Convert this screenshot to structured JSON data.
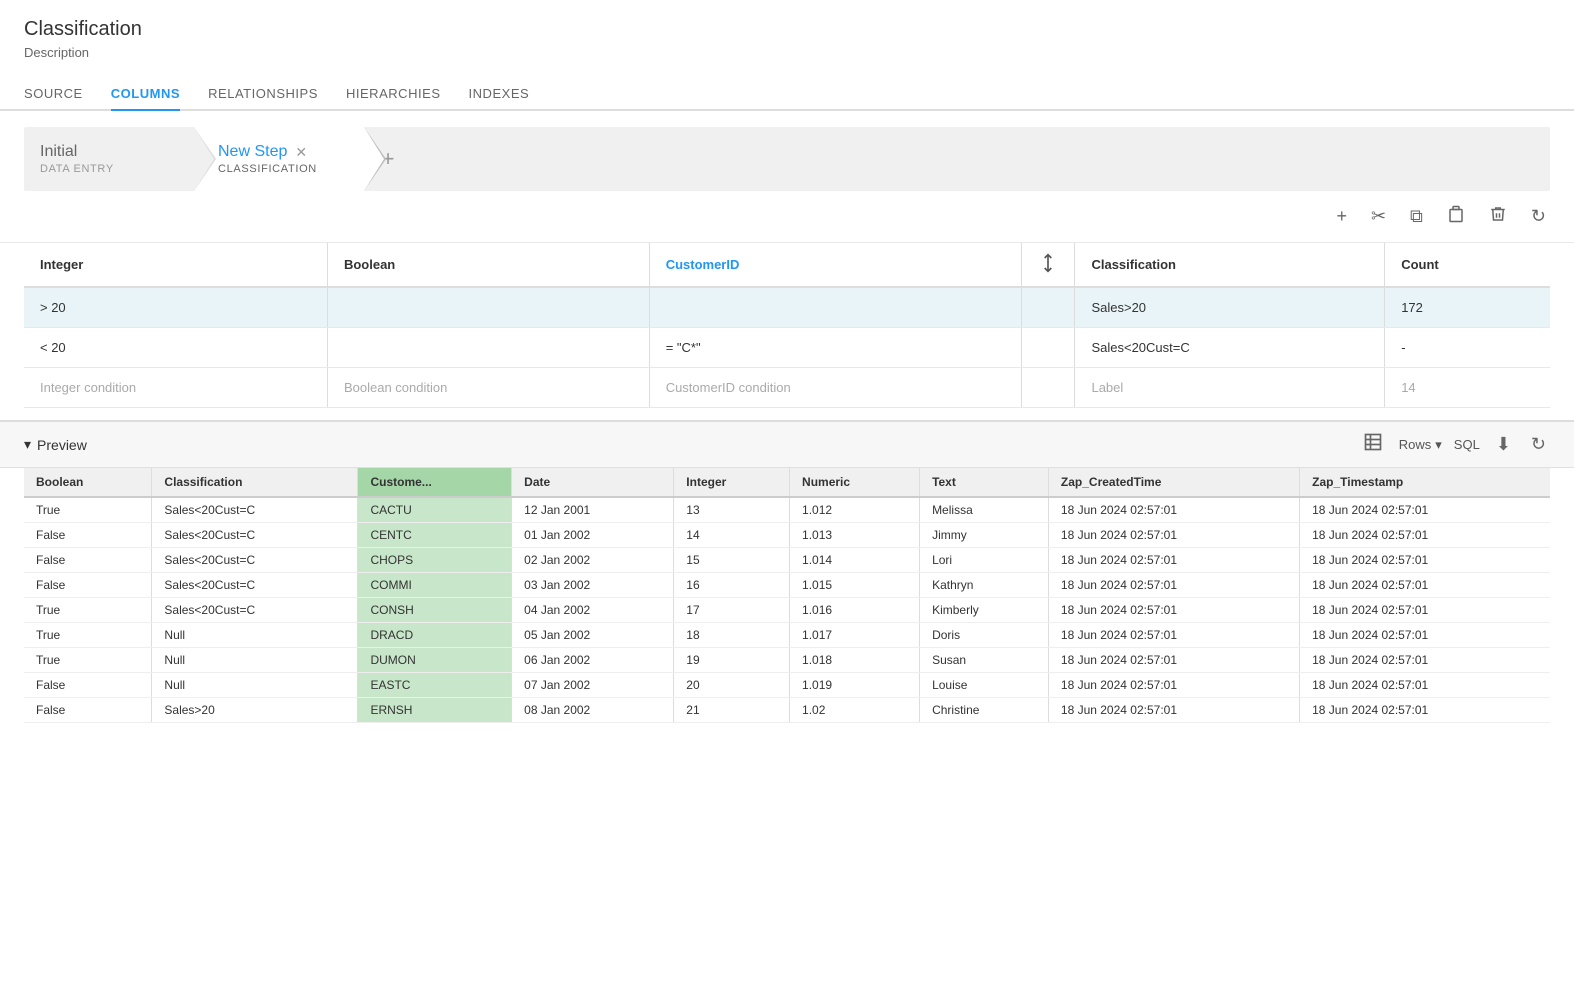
{
  "header": {
    "title": "Classification",
    "description": "Description"
  },
  "nav": {
    "tabs": [
      {
        "label": "SOURCE",
        "active": false
      },
      {
        "label": "COLUMNS",
        "active": true
      },
      {
        "label": "RELATIONSHIPS",
        "active": false
      },
      {
        "label": "HIERARCHIES",
        "active": false
      },
      {
        "label": "INDEXES",
        "active": false
      }
    ]
  },
  "steps": [
    {
      "name": "Initial",
      "sub": "DATA ENTRY",
      "active": false,
      "closeable": false
    },
    {
      "name": "New Step",
      "sub": "CLASSIFICATION",
      "active": true,
      "closeable": true
    }
  ],
  "toolbar": {
    "add": "+",
    "cut": "✂",
    "copy": "⧉",
    "paste": "⎗",
    "delete": "🗑",
    "refresh": "↻"
  },
  "classification_table": {
    "columns": [
      {
        "label": "Integer",
        "type": "normal"
      },
      {
        "label": "Boolean",
        "type": "normal"
      },
      {
        "label": "CustomerID",
        "type": "link"
      },
      {
        "label": "",
        "type": "sort-icon"
      },
      {
        "label": "Classification",
        "type": "normal"
      },
      {
        "label": "Count",
        "type": "normal"
      }
    ],
    "rows": [
      {
        "integer": "> 20",
        "boolean": "",
        "customerid": "",
        "classification": "Sales>20",
        "count": "172",
        "highlight": true
      },
      {
        "integer": "< 20",
        "boolean": "",
        "customerid": "= \"C*\"",
        "classification": "Sales<20Cust=C",
        "count": "-",
        "highlight": false
      },
      {
        "integer": "Integer condition",
        "boolean": "Boolean condition",
        "customerid": "CustomerID condition",
        "classification": "Label",
        "count": "14",
        "placeholder": true
      }
    ]
  },
  "preview": {
    "title": "Preview",
    "chevron": "▾",
    "controls": {
      "table_icon": "≡",
      "rows_label": "Rows",
      "chevron": "▾",
      "sql_label": "SQL",
      "download_icon": "⬇",
      "refresh_icon": "↻"
    },
    "columns": [
      {
        "label": "Boolean",
        "highlighted": false
      },
      {
        "label": "Classification",
        "highlighted": false
      },
      {
        "label": "Custome...",
        "highlighted": true
      },
      {
        "label": "Date",
        "highlighted": false
      },
      {
        "label": "Integer",
        "highlighted": false
      },
      {
        "label": "Numeric",
        "highlighted": false
      },
      {
        "label": "Text",
        "highlighted": false
      },
      {
        "label": "Zap_CreatedTime",
        "highlighted": false
      },
      {
        "label": "Zap_Timestamp",
        "highlighted": false
      }
    ],
    "rows": [
      {
        "boolean": "True",
        "classification": "Sales<20Cust=C",
        "customer": "CACTU",
        "date": "12 Jan 2001",
        "integer": "13",
        "numeric": "1.012",
        "text": "Melissa",
        "created": "18 Jun 2024 02:57:01",
        "timestamp": "18 Jun 2024 02:57:01"
      },
      {
        "boolean": "False",
        "classification": "Sales<20Cust=C",
        "customer": "CENTC",
        "date": "01 Jan 2002",
        "integer": "14",
        "numeric": "1.013",
        "text": "Jimmy",
        "created": "18 Jun 2024 02:57:01",
        "timestamp": "18 Jun 2024 02:57:01"
      },
      {
        "boolean": "False",
        "classification": "Sales<20Cust=C",
        "customer": "CHOPS",
        "date": "02 Jan 2002",
        "integer": "15",
        "numeric": "1.014",
        "text": "Lori",
        "created": "18 Jun 2024 02:57:01",
        "timestamp": "18 Jun 2024 02:57:01"
      },
      {
        "boolean": "False",
        "classification": "Sales<20Cust=C",
        "customer": "COMMI",
        "date": "03 Jan 2002",
        "integer": "16",
        "numeric": "1.015",
        "text": "Kathryn",
        "created": "18 Jun 2024 02:57:01",
        "timestamp": "18 Jun 2024 02:57:01"
      },
      {
        "boolean": "True",
        "classification": "Sales<20Cust=C",
        "customer": "CONSH",
        "date": "04 Jan 2002",
        "integer": "17",
        "numeric": "1.016",
        "text": "Kimberly",
        "created": "18 Jun 2024 02:57:01",
        "timestamp": "18 Jun 2024 02:57:01"
      },
      {
        "boolean": "True",
        "classification": "Null",
        "customer": "DRACD",
        "date": "05 Jan 2002",
        "integer": "18",
        "numeric": "1.017",
        "text": "Doris",
        "created": "18 Jun 2024 02:57:01",
        "timestamp": "18 Jun 2024 02:57:01"
      },
      {
        "boolean": "True",
        "classification": "Null",
        "customer": "DUMON",
        "date": "06 Jan 2002",
        "integer": "19",
        "numeric": "1.018",
        "text": "Susan",
        "created": "18 Jun 2024 02:57:01",
        "timestamp": "18 Jun 2024 02:57:01"
      },
      {
        "boolean": "False",
        "classification": "Null",
        "customer": "EASTC",
        "date": "07 Jan 2002",
        "integer": "20",
        "numeric": "1.019",
        "text": "Louise",
        "created": "18 Jun 2024 02:57:01",
        "timestamp": "18 Jun 2024 02:57:01"
      },
      {
        "boolean": "False",
        "classification": "Sales>20",
        "customer": "ERNSH",
        "date": "08 Jan 2002",
        "integer": "21",
        "numeric": "1.02",
        "text": "Christine",
        "created": "18 Jun 2024 02:57:01",
        "timestamp": "18 Jun 2024 02:57:01"
      }
    ]
  }
}
